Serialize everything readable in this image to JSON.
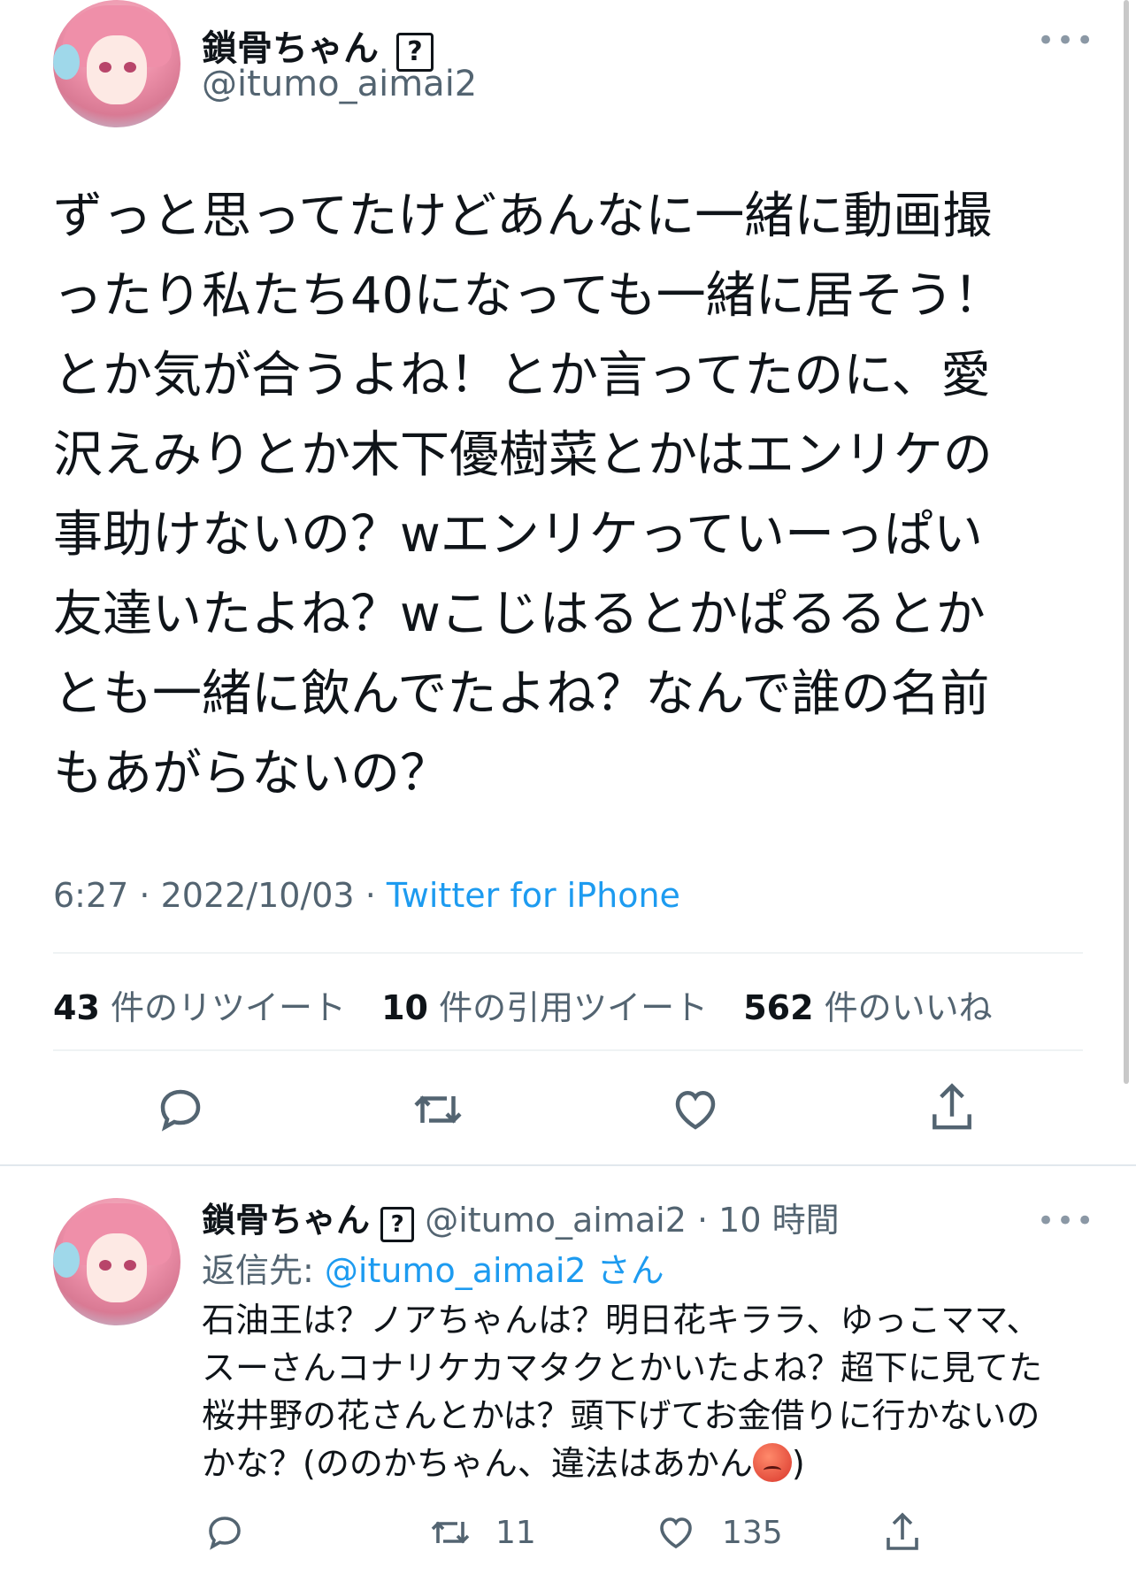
{
  "main_tweet": {
    "display_name": "鎖骨ちゃん",
    "badge": "?",
    "handle": "@itumo_aimai2",
    "more": "•••",
    "text": "ずっと思ってたけどあんなに一緒に動画撮\nったり私たち40になっても一緒に居そう！\nとか気が合うよね！とか言ってたのに、愛\n沢えみりとか木下優樹菜とかはエンリケの\n事助けないの？wエンリケっていーっぱい\n友達いたよね？wこじはるとかぱるるとか\nとも一緒に飲んでたよね？なんで誰の名前\nもあがらないの？",
    "time": "6:27",
    "sep": " · ",
    "date": "2022/10/03",
    "source": "Twitter for iPhone"
  },
  "stats": {
    "retweets_count": "43",
    "retweets_label": "件のリツイート",
    "quotes_count": "10",
    "quotes_label": "件の引用ツイート",
    "likes_count": "562",
    "likes_label": "件のいいね"
  },
  "reply_tweet": {
    "display_name": "鎖骨ちゃん",
    "badge": "?",
    "handle": "@itumo_aimai2",
    "time_ago": "· 10 時間",
    "more": "•••",
    "reply_to_prefix": "返信先: ",
    "reply_to_handle": "@itumo_aimai2",
    "reply_to_suffix": " さん",
    "text_before_emoji": "石油王は？ノアちゃんは？明日花キララ、ゆっこママ、\nスーさんコナリケカマタクとかいたよね？超下に見てた\n桜井野の花さんとかは？頭下げてお金借りに行かないの\nかな？(ののかちゃん、違法はあかん",
    "text_after_emoji": ")",
    "retweet_count": "11",
    "like_count": "135"
  },
  "icons": [
    "reply-icon",
    "retweet-icon",
    "like-icon",
    "share-icon",
    "more-icon",
    "angry-face-emoji"
  ]
}
